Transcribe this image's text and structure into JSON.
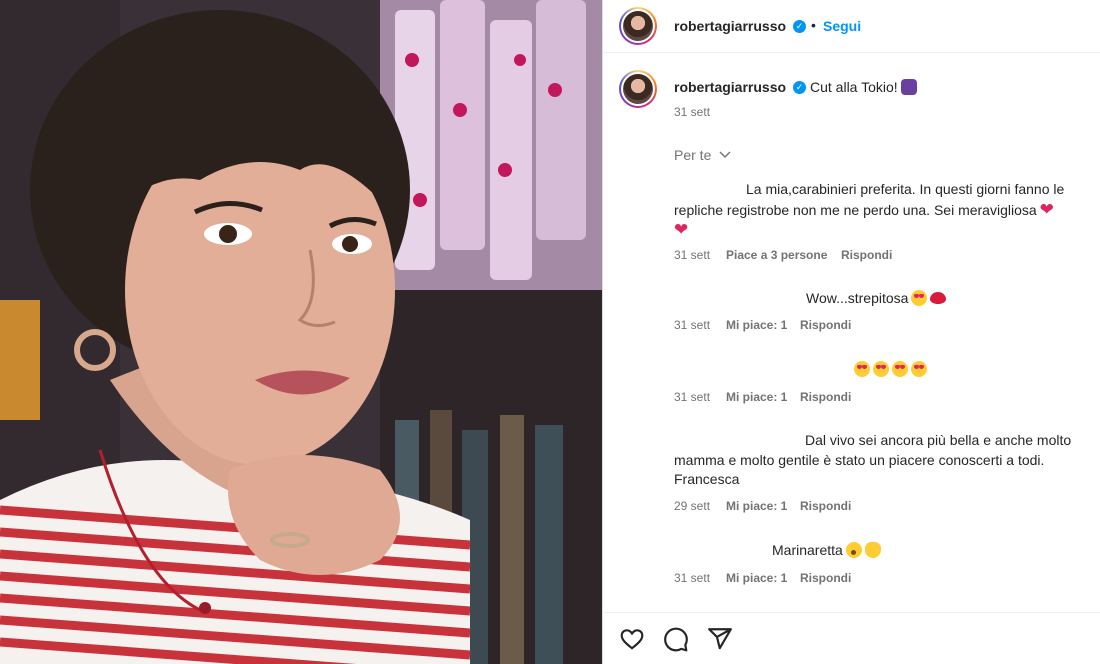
{
  "header": {
    "username": "robertagiarrusso",
    "separator": "•",
    "follow_label": "Segui"
  },
  "caption": {
    "username": "robertagiarrusso",
    "text": "Cut alla Tokio!",
    "time": "31 sett"
  },
  "for_you_label": "Per te",
  "comments": [
    {
      "text": "La mia,carabinieri preferita. In questi giorni fanno le repliche registrobe non me ne perdo una. Sei meravigliosa",
      "time": "31 sett",
      "likes": "Piace a 3 persone",
      "reply": "Rispondi"
    },
    {
      "text": "Wow...strepitosa",
      "time": "31 sett",
      "likes": "Mi piace: 1",
      "reply": "Rispondi"
    },
    {
      "text": "",
      "time": "31 sett",
      "likes": "Mi piace: 1",
      "reply": "Rispondi"
    },
    {
      "text": "Dal vivo sei ancora più bella e anche molto mamma e molto gentile è stato un piacere conoscerti a todi. Francesca",
      "time": "29 sett",
      "likes": "Mi piace: 1",
      "reply": "Rispondi"
    },
    {
      "text": "Marinaretta",
      "time": "31 sett",
      "likes": "Mi piace: 1",
      "reply": "Rispondi"
    }
  ],
  "icons": {
    "like": "heart-icon",
    "comment": "comment-icon",
    "share": "share-icon",
    "verified": "verified-badge-icon",
    "chevron": "chevron-down-icon"
  },
  "colors": {
    "accent": "#0095f6",
    "muted": "#737373",
    "text": "#262626"
  }
}
